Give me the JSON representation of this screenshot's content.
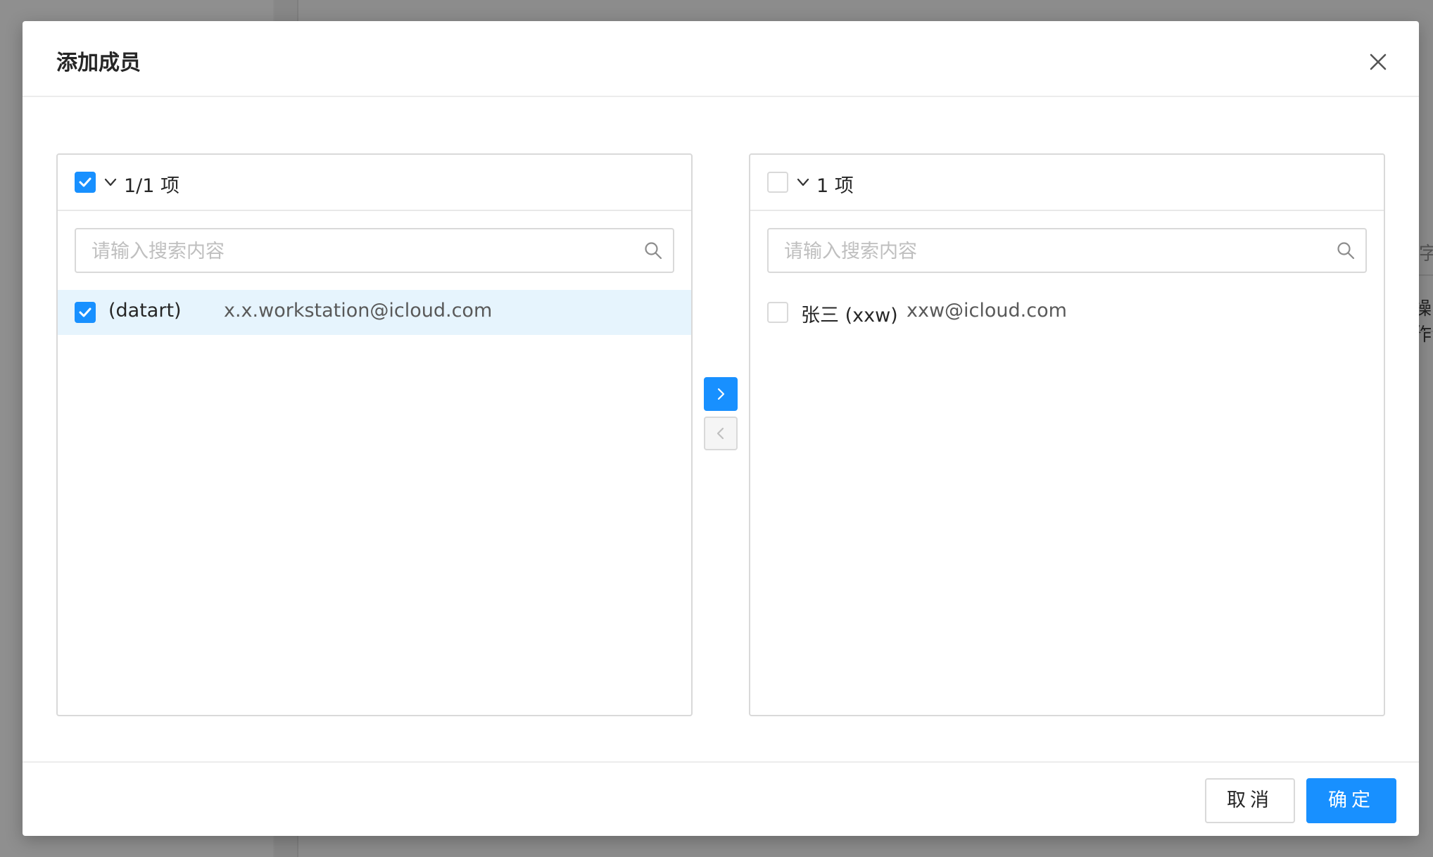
{
  "background": {
    "right_edge_text_1": "字",
    "right_edge_text_2": "操作"
  },
  "modal": {
    "title": "添加成员",
    "close_icon": "close-icon"
  },
  "transfer": {
    "left": {
      "header_checked": true,
      "count_label": "1/1 项",
      "search_placeholder": "请输入搜索内容",
      "items": [
        {
          "name": "(datart)",
          "email": "x.x.workstation@icloud.com",
          "checked": true
        }
      ]
    },
    "right": {
      "header_checked": false,
      "count_label": "1 项",
      "search_placeholder": "请输入搜索内容",
      "items": [
        {
          "name": "张三 (xxw)",
          "email": "xxw@icloud.com",
          "checked": false
        }
      ]
    },
    "to_right_icon": "chevron-right-icon",
    "to_left_icon": "chevron-left-icon"
  },
  "footer": {
    "cancel_label": "取消",
    "ok_label": "确定"
  },
  "colors": {
    "primary": "#1890ff",
    "selected_row": "#e6f4fd",
    "border": "#d9d9d9",
    "overlay": "#8a8a8a"
  }
}
